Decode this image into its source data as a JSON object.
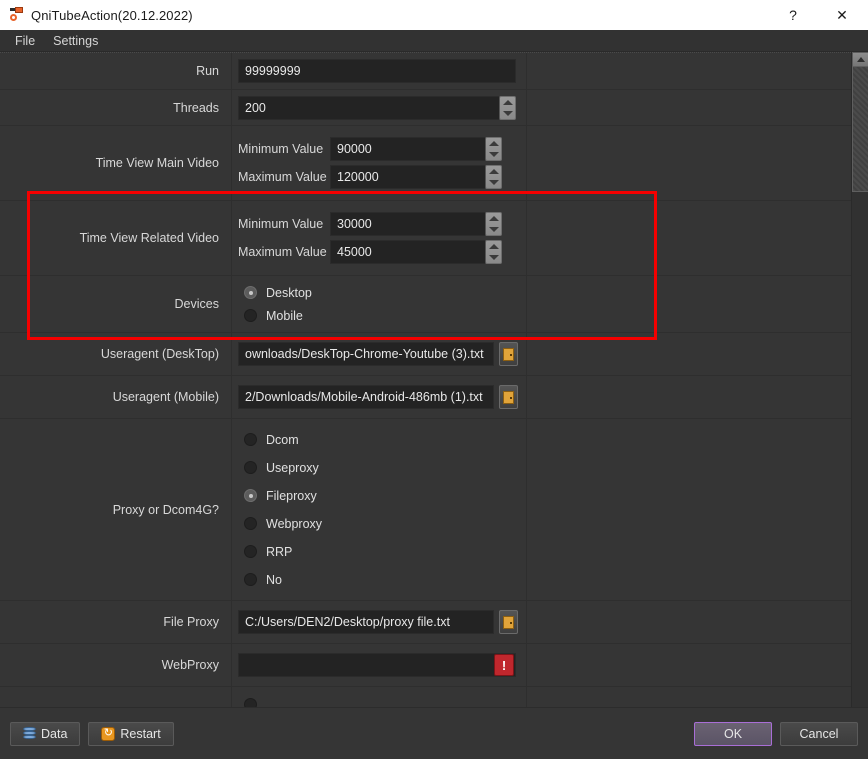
{
  "window": {
    "title": "QniTubeAction(20.12.2022)",
    "icon": "app-icon",
    "help_label": "?",
    "close_label": "✕"
  },
  "menubar": {
    "items": [
      {
        "label": "File"
      },
      {
        "label": "Settings"
      }
    ]
  },
  "form": {
    "rows": [
      {
        "label": "Run",
        "value": "99999999"
      },
      {
        "label": "Threads",
        "value": "200"
      }
    ],
    "time_view_main": {
      "label": "Time View Main Video",
      "min_label": "Minimum Value",
      "min_value": "90000",
      "max_label": "Maximum Value",
      "max_value": "120000"
    },
    "time_view_related": {
      "label": "Time View Related Video",
      "min_label": "Minimum Value",
      "min_value": "30000",
      "max_label": "Maximum Value",
      "max_value": "45000"
    },
    "devices": {
      "label": "Devices",
      "options": [
        {
          "label": "Desktop",
          "selected": true
        },
        {
          "label": "Mobile",
          "selected": false
        }
      ]
    },
    "useragent_desktop": {
      "label": "Useragent (DeskTop)",
      "value": "ownloads/DeskTop-Chrome-Youtube (3).txt",
      "browse_icon": "folder-browse-icon"
    },
    "useragent_mobile": {
      "label": "Useragent  (Mobile)",
      "value": "2/Downloads/Mobile-Android-486mb (1).txt",
      "browse_icon": "folder-browse-icon"
    },
    "proxy_mode": {
      "label": "Proxy or Dcom4G?",
      "options": [
        {
          "label": "Dcom",
          "selected": false
        },
        {
          "label": "Useproxy",
          "selected": false
        },
        {
          "label": "Fileproxy",
          "selected": true
        },
        {
          "label": "Webproxy",
          "selected": false
        },
        {
          "label": "RRP",
          "selected": false
        },
        {
          "label": "No",
          "selected": false
        }
      ]
    },
    "file_proxy": {
      "label": "File Proxy",
      "value": "C:/Users/DEN2/Desktop/proxy file.txt",
      "browse_icon": "folder-browse-icon"
    },
    "web_proxy": {
      "label": "WebProxy",
      "value": "",
      "error_badge": "!"
    }
  },
  "highlight": {
    "name": "red-annotation-rectangle",
    "color": "#f50000"
  },
  "scrollbar": {
    "up_icon": "scroll-up-arrow-icon",
    "down_icon": "scroll-down-arrow-icon"
  },
  "footer": {
    "data_label": "Data",
    "data_icon": "database-icon",
    "restart_label": "Restart",
    "restart_icon": "restart-icon",
    "ok_label": "OK",
    "cancel_label": "Cancel",
    "ok_focus_color": "#a96ed6"
  }
}
